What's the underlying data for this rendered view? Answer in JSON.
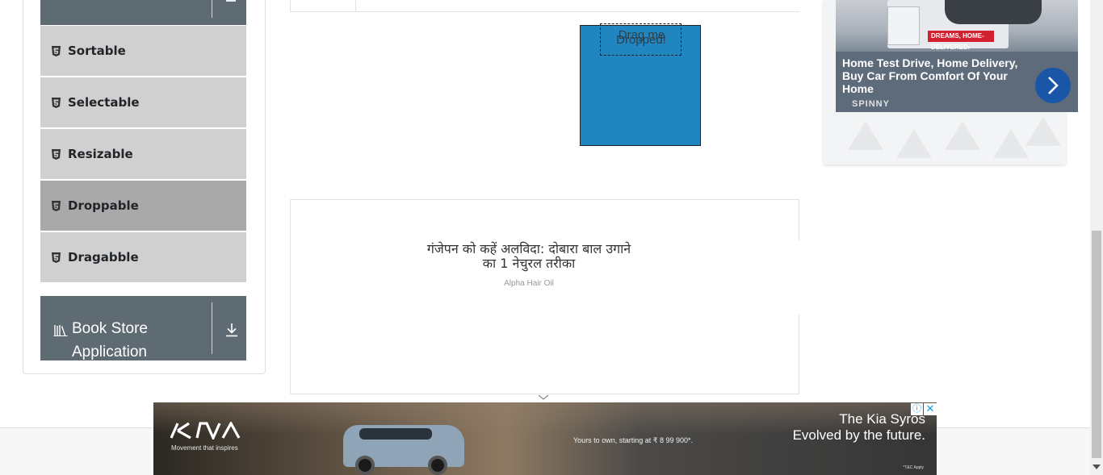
{
  "sidebar": {
    "items": [
      {
        "label": "Sortable",
        "icon": "html5-icon"
      },
      {
        "label": "Selectable",
        "icon": "html5-icon"
      },
      {
        "label": "Resizable",
        "icon": "html5-icon"
      },
      {
        "label": "Droppable",
        "icon": "html5-icon"
      },
      {
        "label": "Dragabble",
        "icon": "html5-icon"
      }
    ],
    "book_store": {
      "title": "Book Store Application",
      "icon": "books-icon"
    }
  },
  "droppable": {
    "target_text": "Dropped!",
    "drag_text": "Drag me",
    "target_color": "#2185bf"
  },
  "mid_ad": {
    "headline": "गंजेपन को कहें अलविदा: दोबारा बाल उगाने का 1 नेचुरल तरीका",
    "brand": "Alpha Hair Oil"
  },
  "right_ad": {
    "badge": "DREAMS, HOME-DELIVERED.",
    "headline": "Home Test Drive, Home Delivery, Buy Car From Comfort Of Your Home",
    "brand": "SPINNY"
  },
  "banner": {
    "tagline": "Movement that inspires",
    "price": "Yours to own, starting at ₹ 8 99 900*.",
    "headline1": "The Kia Syros",
    "headline2": "Evolved by the future.",
    "tnc": "*T&C Apply"
  },
  "colors": {
    "sidebar_item": "#d0d0d0",
    "sidebar_active": "#a9a9a9",
    "group_header": "#5f6b73"
  }
}
